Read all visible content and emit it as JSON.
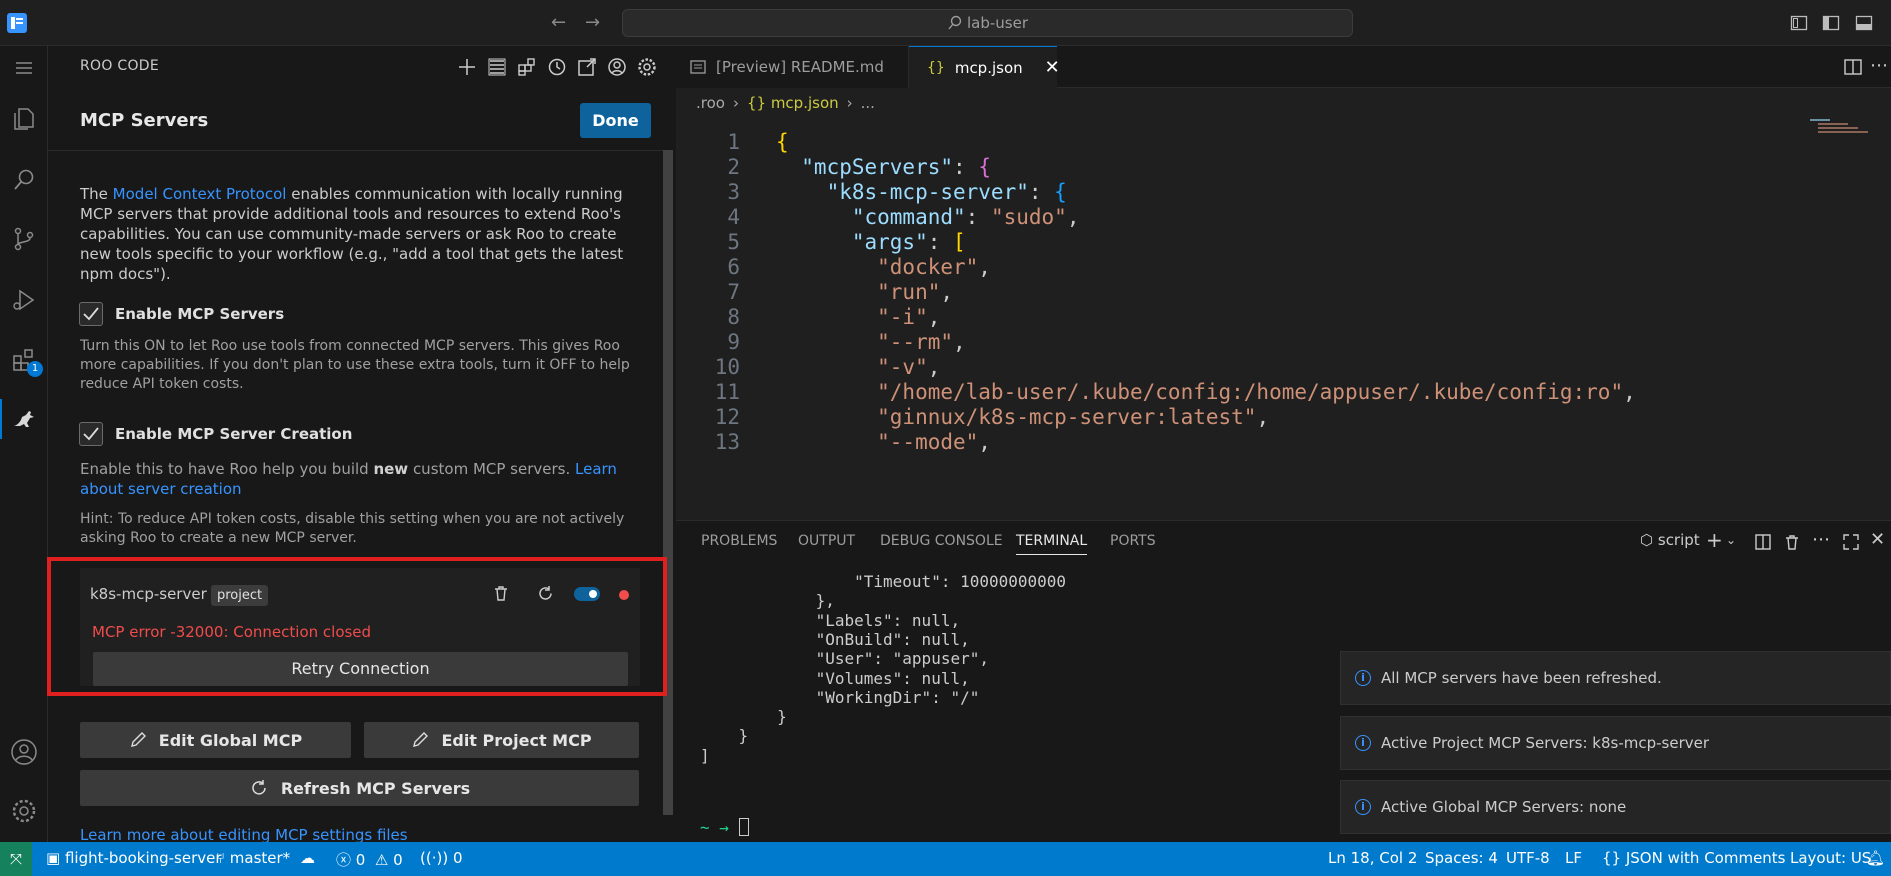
{
  "titlebar": {
    "search": "lab-user"
  },
  "roo": {
    "header": "ROO CODE",
    "title": "MCP Servers",
    "done": "Done",
    "intro_pre": "The ",
    "intro_link": "Model Context Protocol",
    "intro_post": " enables communication with locally running MCP servers that provide additional tools and resources to extend Roo's capabilities. You can use community-made servers or ask Roo to create new tools specific to your workflow (e.g., \"add a tool that gets the latest npm docs\").",
    "enable_servers": {
      "label": "Enable MCP Servers",
      "checked": true,
      "desc": "Turn this ON to let Roo use tools from connected MCP servers. This gives Roo more capabilities. If you don't plan to use these extra tools, turn it OFF to help reduce API token costs."
    },
    "enable_creation": {
      "label": "Enable MCP Server Creation",
      "checked": true,
      "desc_pre": "Enable this to have Roo help you build ",
      "desc_bold": "new",
      "desc_post": " custom MCP servers. ",
      "desc_link": "Learn about server creation"
    },
    "hint": "Hint: To reduce API token costs, disable this setting when you are not actively asking Roo to create a new MCP server.",
    "server": {
      "name": "k8s-mcp-server",
      "tag": "project",
      "error": "MCP error -32000: Connection closed",
      "retry": "Retry Connection",
      "status_color": "#f14c4c"
    },
    "edit_global": "Edit Global MCP",
    "edit_project": "Edit Project MCP",
    "refresh": "Refresh MCP Servers",
    "learn_more": "Learn more about editing MCP settings files"
  },
  "activity": {
    "extensions_badge": "1"
  },
  "editor": {
    "tabs": [
      {
        "label": "[Preview] README.md"
      },
      {
        "label": "mcp.json"
      }
    ],
    "breadcrumb": [
      ".roo",
      "{} mcp.json",
      "..."
    ],
    "line_numbers": [
      "1",
      "2",
      "3",
      "4",
      "5",
      "6",
      "7",
      "8",
      "9",
      "10",
      "11",
      "12",
      "13"
    ],
    "lines": [
      {
        "parts": [
          {
            "t": "{",
            "c": "b1"
          }
        ]
      },
      {
        "parts": [
          {
            "t": "  \"mcpServers\"",
            "c": "k"
          },
          {
            "t": ": ",
            "c": "p"
          },
          {
            "t": "{",
            "c": "b2"
          }
        ]
      },
      {
        "parts": [
          {
            "t": "    \"k8s-mcp-server\"",
            "c": "k"
          },
          {
            "t": ": ",
            "c": "p"
          },
          {
            "t": "{",
            "c": "b3"
          }
        ]
      },
      {
        "parts": [
          {
            "t": "      \"command\"",
            "c": "k"
          },
          {
            "t": ": ",
            "c": "p"
          },
          {
            "t": "\"sudo\"",
            "c": "s"
          },
          {
            "t": ",",
            "c": "p"
          }
        ]
      },
      {
        "parts": [
          {
            "t": "      \"args\"",
            "c": "k"
          },
          {
            "t": ": ",
            "c": "p"
          },
          {
            "t": "[",
            "c": "b1"
          }
        ]
      },
      {
        "parts": [
          {
            "t": "        \"docker\"",
            "c": "s"
          },
          {
            "t": ",",
            "c": "p"
          }
        ]
      },
      {
        "parts": [
          {
            "t": "        \"run\"",
            "c": "s"
          },
          {
            "t": ",",
            "c": "p"
          }
        ]
      },
      {
        "parts": [
          {
            "t": "        \"-i\"",
            "c": "s"
          },
          {
            "t": ",",
            "c": "p"
          }
        ]
      },
      {
        "parts": [
          {
            "t": "        \"--rm\"",
            "c": "s"
          },
          {
            "t": ",",
            "c": "p"
          }
        ]
      },
      {
        "parts": [
          {
            "t": "        \"-v\"",
            "c": "s"
          },
          {
            "t": ",",
            "c": "p"
          }
        ]
      },
      {
        "parts": [
          {
            "t": "        \"/home/lab-user/.kube/config:/home/appuser/.kube/config:ro\"",
            "c": "s"
          },
          {
            "t": ",",
            "c": "p"
          }
        ]
      },
      {
        "parts": [
          {
            "t": "        \"ginnux/k8s-mcp-server:latest\"",
            "c": "s"
          },
          {
            "t": ",",
            "c": "p"
          }
        ]
      },
      {
        "parts": [
          {
            "t": "        \"--mode\"",
            "c": "s"
          },
          {
            "t": ",",
            "c": "p"
          }
        ]
      }
    ]
  },
  "panel": {
    "tabs": [
      "PROBLEMS",
      "OUTPUT",
      "DEBUG CONSOLE",
      "TERMINAL",
      "PORTS"
    ],
    "active_tab": "TERMINAL",
    "terminal_name": "script",
    "terminal_lines": [
      "                \"Timeout\": 10000000000",
      "            },",
      "            \"Labels\": null,",
      "            \"OnBuild\": null,",
      "            \"User\": \"appuser\",",
      "            \"Volumes\": null,",
      "            \"WorkingDir\": \"/\"",
      "        }",
      "    }",
      "]"
    ],
    "prompt": "~ →"
  },
  "notifications": [
    "All MCP servers have been refreshed.",
    "Active Project MCP Servers: k8s-mcp-server",
    "Active Global MCP Servers: none"
  ],
  "status": {
    "repo": "flight-booking-server",
    "branch": "master*",
    "errors": "0",
    "warnings": "0",
    "ports": "0",
    "position": "Ln 18, Col 2",
    "spaces": "Spaces: 4",
    "encoding": "UTF-8",
    "eol": "LF",
    "language": "JSON with Comments",
    "layout": "Layout: US"
  }
}
